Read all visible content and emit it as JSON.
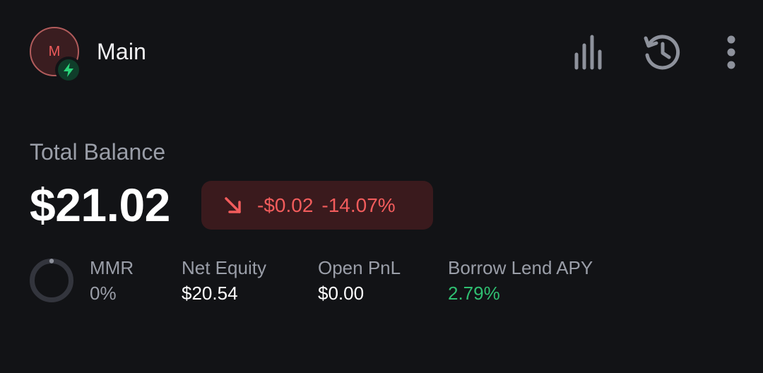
{
  "account": {
    "avatar_letter": "M",
    "name": "Main"
  },
  "toolbar": {
    "icons": [
      "bar-chart-icon",
      "history-icon",
      "more-vertical-icon"
    ]
  },
  "balance": {
    "label": "Total Balance",
    "value": "$21.02",
    "change_amount": "-$0.02",
    "change_percent": "-14.07%"
  },
  "stats": {
    "mmr": {
      "label": "MMR",
      "value": "0%",
      "fraction": 0
    },
    "net_equity": {
      "label": "Net Equity",
      "value": "$20.54"
    },
    "open_pnl": {
      "label": "Open PnL",
      "value": "$0.00"
    },
    "borrow_lend_apy": {
      "label": "Borrow Lend APY",
      "value": "2.79%"
    }
  },
  "colors": {
    "background": "#121316",
    "negative": "#f25c5c",
    "positive": "#2fbf71",
    "muted_text": "#9a9ea8",
    "bolt_green": "#2ad47a"
  }
}
